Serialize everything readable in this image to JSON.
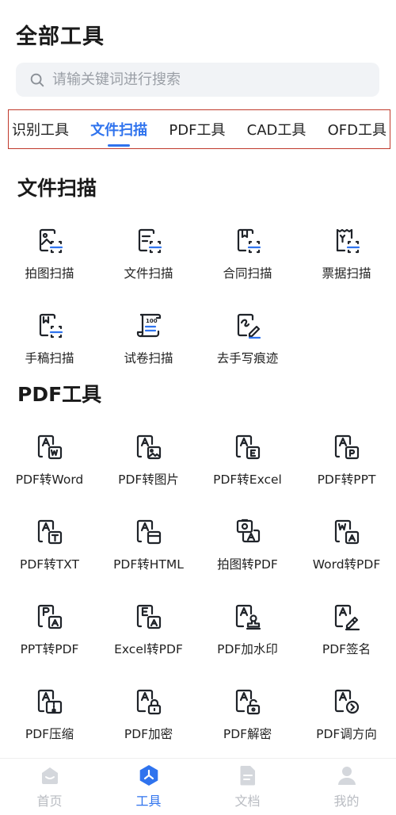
{
  "header": {
    "title": "全部工具"
  },
  "search": {
    "placeholder": "请输关键词进行搜索"
  },
  "tabs": [
    {
      "label": "识别工具",
      "active": false
    },
    {
      "label": "文件扫描",
      "active": true
    },
    {
      "label": "PDF工具",
      "active": false
    },
    {
      "label": "CAD工具",
      "active": false
    },
    {
      "label": "OFD工具",
      "active": false
    }
  ],
  "sections": [
    {
      "title": "文件扫描",
      "items": [
        {
          "label": "拍图扫描",
          "icon": "photo-scan-icon"
        },
        {
          "label": "文件扫描",
          "icon": "file-scan-icon"
        },
        {
          "label": "合同扫描",
          "icon": "contract-scan-icon"
        },
        {
          "label": "票据扫描",
          "icon": "receipt-scan-icon"
        },
        {
          "label": "手稿扫描",
          "icon": "manuscript-scan-icon"
        },
        {
          "label": "试卷扫描",
          "icon": "exam-scan-icon"
        },
        {
          "label": "去手写痕迹",
          "icon": "remove-handwriting-icon"
        }
      ]
    },
    {
      "title": "PDF工具",
      "items": [
        {
          "label": "PDF转Word",
          "icon": "pdf-to-word-icon"
        },
        {
          "label": "PDF转图片",
          "icon": "pdf-to-image-icon"
        },
        {
          "label": "PDF转Excel",
          "icon": "pdf-to-excel-icon"
        },
        {
          "label": "PDF转PPT",
          "icon": "pdf-to-ppt-icon"
        },
        {
          "label": "PDF转TXT",
          "icon": "pdf-to-txt-icon"
        },
        {
          "label": "PDF转HTML",
          "icon": "pdf-to-html-icon"
        },
        {
          "label": "拍图转PDF",
          "icon": "photo-to-pdf-icon"
        },
        {
          "label": "Word转PDF",
          "icon": "word-to-pdf-icon"
        },
        {
          "label": "PPT转PDF",
          "icon": "ppt-to-pdf-icon"
        },
        {
          "label": "Excel转PDF",
          "icon": "excel-to-pdf-icon"
        },
        {
          "label": "PDF加水印",
          "icon": "pdf-watermark-icon"
        },
        {
          "label": "PDF签名",
          "icon": "pdf-sign-icon"
        },
        {
          "label": "PDF压缩",
          "icon": "pdf-compress-icon"
        },
        {
          "label": "PDF加密",
          "icon": "pdf-encrypt-icon"
        },
        {
          "label": "PDF解密",
          "icon": "pdf-decrypt-icon"
        },
        {
          "label": "PDF调方向",
          "icon": "pdf-rotate-icon"
        }
      ]
    }
  ],
  "bottom_nav": [
    {
      "label": "首页",
      "icon": "home-icon",
      "active": false
    },
    {
      "label": "工具",
      "icon": "tools-icon",
      "active": true
    },
    {
      "label": "文档",
      "icon": "document-icon",
      "active": false
    },
    {
      "label": "我的",
      "icon": "profile-icon",
      "active": false
    }
  ],
  "colors": {
    "accent": "#2f73ee",
    "icon_stroke": "#1f2329",
    "nav_inactive": "#b9bcc2",
    "tab_highlight_border": "#c0392b"
  }
}
